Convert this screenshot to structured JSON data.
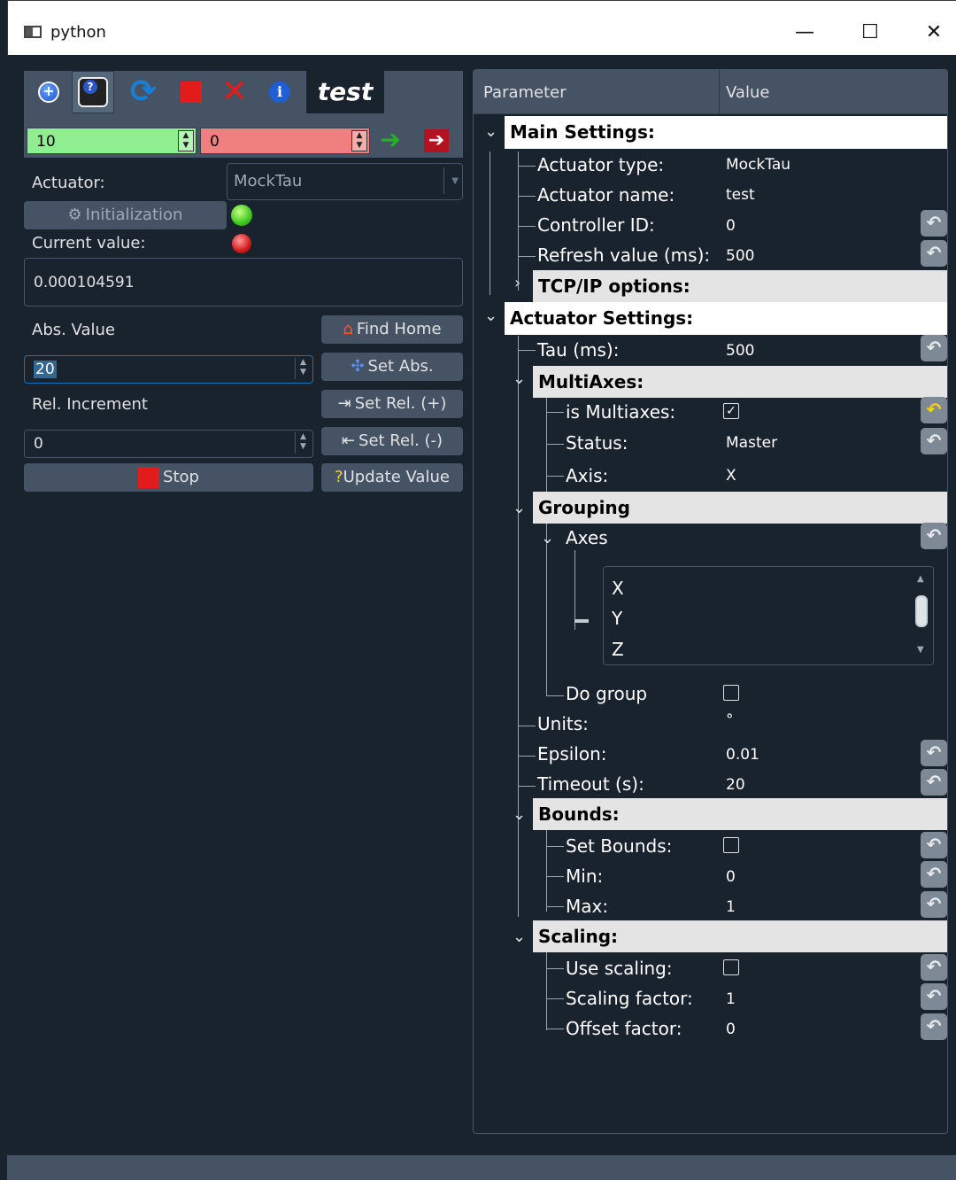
{
  "window": {
    "title": "python",
    "minimize": "—",
    "maximize": "☐",
    "close": "✕"
  },
  "toolbar": {
    "name_label": "test",
    "icons": [
      "add-icon",
      "settings-help-icon",
      "refresh-icon",
      "stop-icon",
      "quit-icon",
      "info-icon"
    ]
  },
  "range": {
    "low": "10",
    "high": "0"
  },
  "left": {
    "actuator_label": "Actuator:",
    "actuator_value": "MockTau",
    "init_button": "Initialization",
    "current_value_label": "Current value:",
    "current_value": "0.000104591",
    "abs_value_label": "Abs. Value",
    "abs_value": "20",
    "rel_increment_label": "Rel. Increment",
    "rel_increment": "0",
    "find_home": "Find Home",
    "set_abs": "Set Abs.",
    "set_rel_plus": "Set Rel. (+)",
    "set_rel_minus": "Set Rel. (-)",
    "stop": "Stop",
    "update_value": "Update Value"
  },
  "tree": {
    "header": {
      "parameter": "Parameter",
      "value": "Value"
    },
    "main_settings": "Main Settings:",
    "actuator_type_label": "Actuator type:",
    "actuator_type": "MockTau",
    "actuator_name_label": "Actuator name:",
    "actuator_name": "test",
    "controller_id_label": "Controller ID:",
    "controller_id": "0",
    "refresh_label": "Refresh value (ms):",
    "refresh": "500",
    "tcpip": "TCP/IP options:",
    "actuator_settings": "Actuator Settings:",
    "tau_label": "Tau (ms):",
    "tau": "500",
    "multiaxes": "MultiAxes:",
    "is_multiaxes_label": "is Multiaxes:",
    "is_multiaxes": "✓",
    "status_label": "Status:",
    "status": "Master",
    "axis_label": "Axis:",
    "axis": "X",
    "grouping": "Grouping",
    "axes_label": "Axes",
    "axes_items": [
      "X",
      "Y",
      "Z"
    ],
    "do_group_label": "Do group",
    "units_label": "Units:",
    "units": "°",
    "epsilon_label": "Epsilon:",
    "epsilon": "0.01",
    "timeout_label": "Timeout (s):",
    "timeout": "20",
    "bounds": "Bounds:",
    "set_bounds_label": "Set Bounds:",
    "min_label": "Min:",
    "min": "0",
    "max_label": "Max:",
    "max": "1",
    "scaling": "Scaling:",
    "use_scaling_label": "Use scaling:",
    "scaling_factor_label": "Scaling factor:",
    "scaling_factor": "1",
    "offset_factor_label": "Offset factor:",
    "offset_factor": "0"
  },
  "colors": {
    "bg": "#19232d",
    "panel": "#455364",
    "green_field": "#90ee90",
    "red_field": "#f08080"
  }
}
